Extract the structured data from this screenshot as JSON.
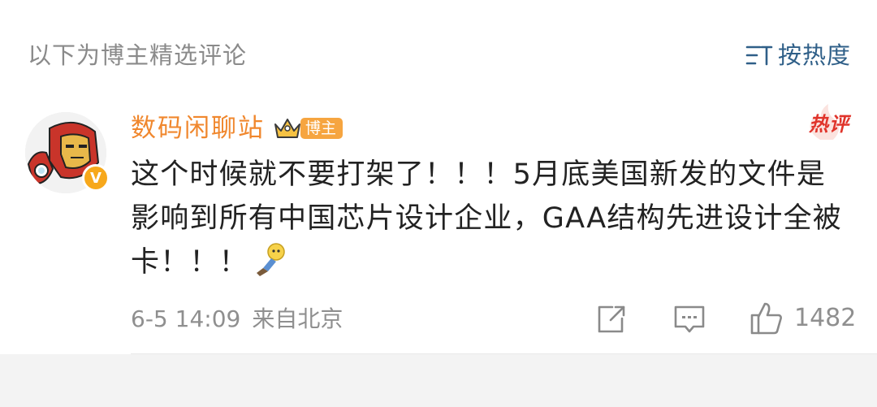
{
  "header": {
    "section_label": "以下为博主精选评论",
    "sort_label": "按热度",
    "sort_icon": "sort-icon"
  },
  "comment": {
    "username": "数码闲聊站",
    "blogger_badge": "博主",
    "hot_badge": "热评",
    "verified_badge": "V",
    "text": "这个时候就不要打架了！！！5月底美国新发的文件是影响到所有中国芯片设计企业，GAA结构先进设计全被卡！！！",
    "emoji": "doge-emoji",
    "date": "6-5 14:09",
    "source": "来自北京",
    "likes": "1482"
  },
  "colors": {
    "username": "#f0872d",
    "sort_label": "#2f5f88",
    "hot": "#e0342b",
    "badge": "#f6a540",
    "muted": "#8f8f8f",
    "text": "#222222"
  }
}
